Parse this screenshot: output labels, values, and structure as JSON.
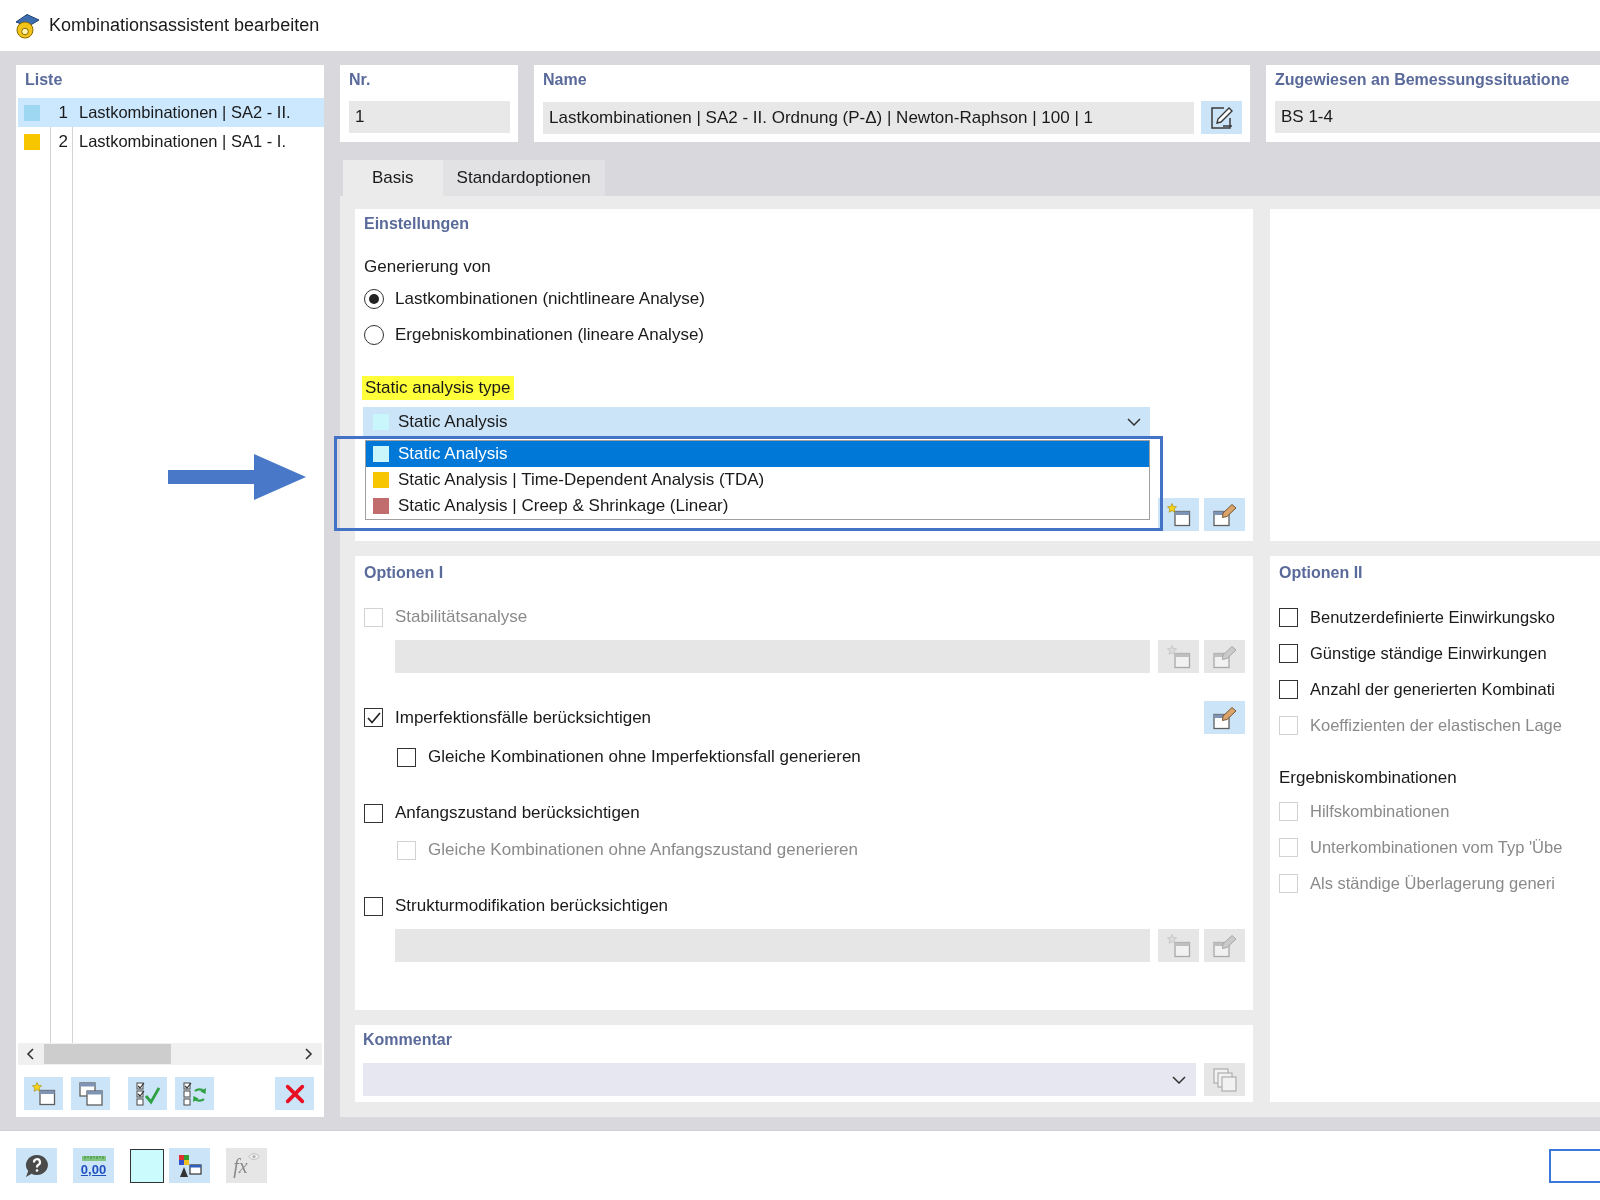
{
  "window": {
    "title": "Kombinationsassistent bearbeiten"
  },
  "list": {
    "title": "Liste",
    "items": [
      {
        "number": "1",
        "label": "Lastkombinationen | SA2 - II.",
        "color": "#9ed7f1",
        "selected": true
      },
      {
        "number": "2",
        "label": "Lastkombinationen | SA1 - I.",
        "color": "#f7c600",
        "selected": false
      }
    ],
    "tools": [
      {
        "kind": "new",
        "disabled": false
      },
      {
        "kind": "copy",
        "disabled": false
      },
      {
        "kind": "check",
        "disabled": false
      },
      {
        "kind": "check_refresh",
        "disabled": false
      },
      {
        "kind": "delete",
        "disabled": false
      }
    ]
  },
  "header": {
    "number": {
      "label": "Nr.",
      "value": "1"
    },
    "name": {
      "label": "Name",
      "value": "Lastkombinationen | SA2 - II. Ordnung (P-Δ) | Newton-Raphson | 100 | 1",
      "tools": [
        {
          "kind": "pencil",
          "disabled": false
        }
      ]
    },
    "design_situation": {
      "label": "Zugewiesen an Bemessungssituatione",
      "value": "BS 1-4"
    }
  },
  "tabs": [
    {
      "label": "Basis",
      "selected": true
    },
    {
      "label": "Standardoptionen",
      "selected": false
    }
  ],
  "settings": {
    "title": "Einstellungen",
    "generation": {
      "label": "Generierung von",
      "options": [
        {
          "label": "Lastkombinationen (nichtlineare Analyse)",
          "selected": true
        },
        {
          "label": "Ergebniskombinationen (lineare Analyse)",
          "selected": false
        }
      ]
    },
    "analysis_type": {
      "label": "Static analysis type",
      "highlighted": true,
      "value": "Static Analysis",
      "expanded": true,
      "options": [
        {
          "label": "Static Analysis",
          "color": "#c8f6fb",
          "selected": true
        },
        {
          "label": "Static Analysis | Time-Dependent Analysis (TDA)",
          "color": "#f7c600",
          "selected": false
        },
        {
          "label": "Static Analysis | Creep & Shrinkage (Linear)",
          "color": "#c26d6d",
          "selected": false
        }
      ]
    },
    "tools": [
      {
        "kind": "new",
        "disabled": false
      },
      {
        "kind": "edit",
        "disabled": false
      }
    ]
  },
  "options_1": {
    "title": "Optionen I",
    "items": [
      {
        "label": "Stabilitätsanalyse",
        "checked": false,
        "disabled": true,
        "field": {
          "disabled": true,
          "tools": [
            {
              "kind": "new",
              "disabled": true
            },
            {
              "kind": "edit",
              "disabled": true
            }
          ]
        }
      },
      {
        "label": "Imperfektionsfälle berücksichtigen",
        "checked": true,
        "disabled": false,
        "tools": [
          {
            "kind": "edit",
            "disabled": false
          }
        ],
        "children": [
          {
            "label": "Gleiche Kombinationen ohne Imperfektionsfall generieren",
            "checked": false,
            "disabled": false
          }
        ]
      },
      {
        "label": "Anfangszustand berücksichtigen",
        "checked": false,
        "disabled": false,
        "children": [
          {
            "label": "Gleiche Kombinationen ohne Anfangszustand generieren",
            "checked": false,
            "disabled": true
          }
        ]
      },
      {
        "label": "Strukturmodifikation berücksichtigen",
        "checked": false,
        "disabled": false,
        "field": {
          "disabled": true,
          "tools": [
            {
              "kind": "new",
              "disabled": true
            },
            {
              "kind": "edit",
              "disabled": true
            }
          ]
        }
      }
    ]
  },
  "options_2": {
    "title": "Optionen II",
    "items": [
      {
        "kind": "checkbox",
        "label": "Benutzerdefinierte Einwirkungsko",
        "checked": false,
        "disabled": false
      },
      {
        "kind": "checkbox",
        "label": "Günstige ständige Einwirkungen",
        "checked": false,
        "disabled": false
      },
      {
        "kind": "checkbox",
        "label": "Anzahl der generierten Kombinati",
        "checked": false,
        "disabled": false
      },
      {
        "kind": "checkbox",
        "label": "Koeffizienten der elastischen Lage",
        "checked": false,
        "disabled": true
      },
      {
        "kind": "heading",
        "label": "Ergebniskombinationen"
      },
      {
        "kind": "checkbox",
        "label": "Hilfskombinationen",
        "checked": false,
        "disabled": true
      },
      {
        "kind": "checkbox",
        "label": "Unterkombinationen vom Typ 'Übe",
        "checked": false,
        "disabled": true
      },
      {
        "kind": "checkbox",
        "label": "Als ständige Überlagerung generi",
        "checked": false,
        "disabled": true
      }
    ]
  },
  "comment": {
    "title": "Kommentar",
    "tools": [
      {
        "kind": "duplicate",
        "disabled": true
      }
    ]
  },
  "bottom_toolbar": [
    {
      "kind": "help",
      "disabled": false
    },
    {
      "kind": "decimals",
      "label": "0,00",
      "disabled": false
    },
    {
      "kind": "color",
      "disabled": false
    },
    {
      "kind": "display",
      "disabled": false
    },
    {
      "kind": "formula",
      "label": "fx",
      "disabled": true
    }
  ]
}
